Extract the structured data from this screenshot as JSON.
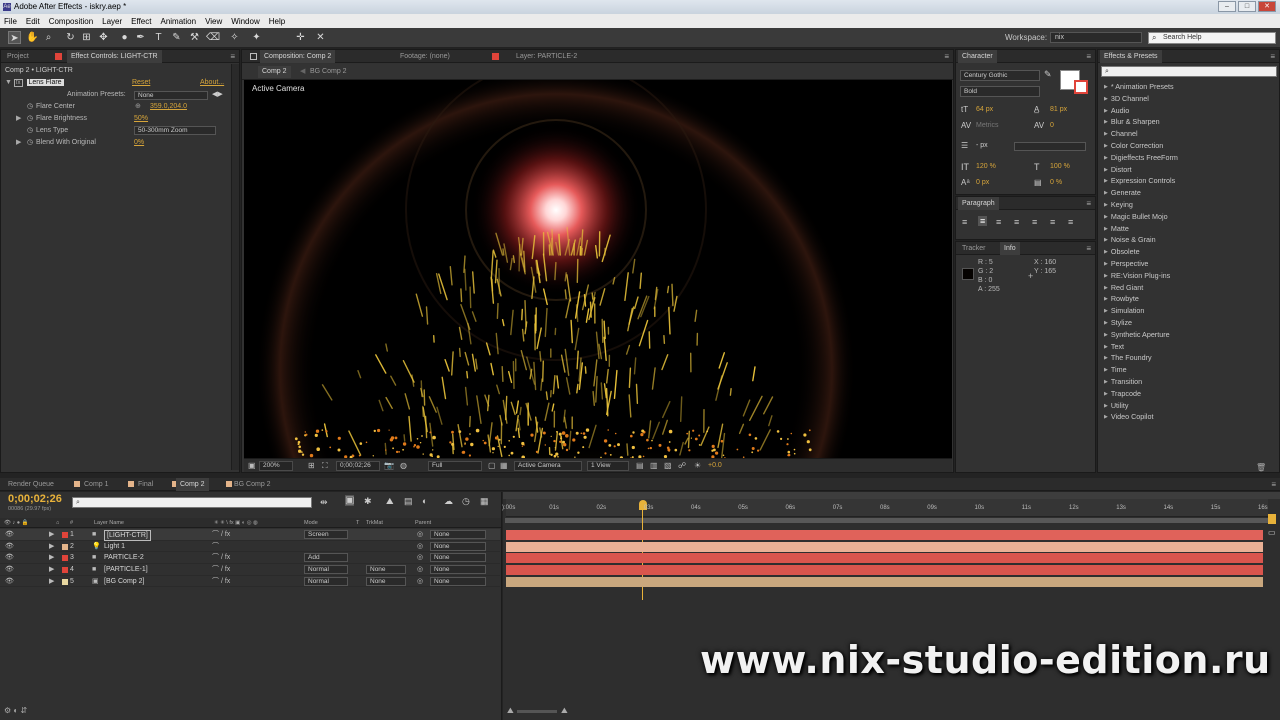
{
  "window": {
    "title": "Adobe After Effects - iskry.aep *",
    "app_icon": "Ae",
    "min": "–",
    "max": "□",
    "close": "✕"
  },
  "menu": [
    "File",
    "Edit",
    "Composition",
    "Layer",
    "Effect",
    "Animation",
    "View",
    "Window",
    "Help"
  ],
  "toolbar": {
    "workspace_label": "Workspace:",
    "workspace_value": "nix",
    "search_placeholder": "Search Help"
  },
  "effect_controls": {
    "tab_project": "Project",
    "tab_effect": "Effect Controls: LIGHT-CTR",
    "breadcrumb": "Comp 2 • LIGHT-CTR",
    "effect_name": "Lens Flare",
    "reset": "Reset",
    "about": "About...",
    "presets_label": "Animation Presets:",
    "presets_value": "None",
    "props": [
      {
        "label": "Flare Center",
        "value": "359.0,204.0"
      },
      {
        "label": "Flare Brightness",
        "value": "50%"
      },
      {
        "label": "Lens Type",
        "value": "50-300mm Zoom"
      },
      {
        "label": "Blend With Original",
        "value": "0%"
      }
    ]
  },
  "composition": {
    "tab_comp": "Composition: Comp 2",
    "tab_footage": "Footage: (none)",
    "tab_layer": "Layer: PARTICLE-2",
    "sub_tab_1": "Comp 2",
    "sub_tab_2": "BG Comp 2",
    "view_label": "Active Camera",
    "bottom": {
      "zoom": "200%",
      "time": "0;00;02;26",
      "resolution": "Full",
      "camera": "Active Camera",
      "views": "1 View",
      "exposure": "+0.0"
    }
  },
  "character": {
    "tab": "Character",
    "font": "Century Gothic",
    "style": "Bold",
    "size": "64 px",
    "leading": "81 px",
    "tracking_label": "Metrics",
    "tracking": "0",
    "stroke": "- px",
    "vscale": "120 %",
    "hscale": "100 %",
    "baseline": "0 px",
    "tsume": "0 %"
  },
  "paragraph": {
    "tab": "Paragraph"
  },
  "info": {
    "tab_tracker": "Tracker",
    "tab_info": "Info",
    "r": "R : 5",
    "g": "G : 2",
    "b": "B : 0",
    "a": "A : 255",
    "x": "X : 160",
    "y": "Y : 165"
  },
  "effects_presets": {
    "tab": "Effects & Presets",
    "items": [
      "* Animation Presets",
      "3D Channel",
      "Audio",
      "Blur & Sharpen",
      "Channel",
      "Color Correction",
      "Digieffects FreeForm",
      "Distort",
      "Expression Controls",
      "Generate",
      "Keying",
      "Magic Bullet Mojo",
      "Matte",
      "Noise & Grain",
      "Obsolete",
      "Perspective",
      "RE:Vision Plug-ins",
      "Red Giant",
      "Rowbyte",
      "Simulation",
      "Stylize",
      "Synthetic Aperture",
      "Text",
      "The Foundry",
      "Time",
      "Transition",
      "Trapcode",
      "Utility",
      "Video Copilot"
    ]
  },
  "timeline": {
    "tabs": [
      "Render Queue",
      "Comp 1",
      "Final",
      "Comp 2",
      "BG Comp 2"
    ],
    "timecode": "0;00;02;26",
    "fps": "00086 (29.97 fps)",
    "col_layer_name": "Layer Name",
    "col_mode": "Mode",
    "col_t": "T",
    "col_trkmat": "TrkMat",
    "col_parent": "Parent",
    "col_num": "#",
    "ruler": [
      "):00s",
      "01s",
      "02s",
      "03s",
      "04s",
      "05s",
      "06s",
      "07s",
      "08s",
      "09s",
      "10s",
      "11s",
      "12s",
      "13s",
      "14s",
      "15s",
      "16s"
    ],
    "layers": [
      {
        "num": "1",
        "name": "[LIGHT-CTR]",
        "mode": "Screen",
        "trkmat": "",
        "parent": "None",
        "label_color": "#e0443a",
        "bar_color": "#e0625a"
      },
      {
        "num": "2",
        "name": "Light 1",
        "mode": "",
        "trkmat": "",
        "parent": "None",
        "label_color": "#e4b48a",
        "bar_color": "#e9b095"
      },
      {
        "num": "3",
        "name": "PARTICLE-2",
        "mode": "Add",
        "trkmat": "",
        "parent": "None",
        "label_color": "#e0443a",
        "bar_color": "#d9554d"
      },
      {
        "num": "4",
        "name": "[PARTICLE-1]",
        "mode": "Normal",
        "trkmat": "None",
        "parent": "None",
        "label_color": "#e0443a",
        "bar_color": "#d9554d"
      },
      {
        "num": "5",
        "name": "[BG Comp 2]",
        "mode": "Normal",
        "trkmat": "None",
        "parent": "None",
        "label_color": "#e8d7a0",
        "bar_color": "#c9a77e"
      }
    ]
  },
  "watermark": "www.nix-studio-edition.ru"
}
